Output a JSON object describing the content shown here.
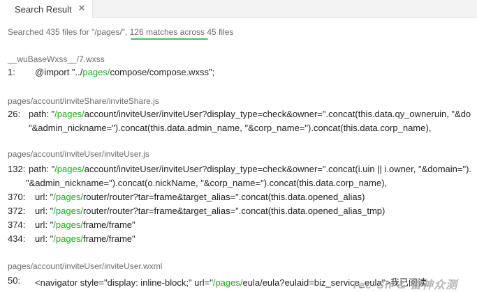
{
  "tab": {
    "label": "Search Result",
    "close_icon": "close-icon"
  },
  "summary": {
    "prefix": "Searched 435 files for \"/pages/\", ",
    "matches": "126 matches across 45 files"
  },
  "files": [
    {
      "path": "__wuBaseWxss__/7.wxss",
      "lines": [
        {
          "num": "1:",
          "pre": "@import \"../",
          "hl": "pages/",
          "post": "compose/compose.wxss\";"
        }
      ]
    },
    {
      "path": "pages/account/inviteShare/inviteShare.js",
      "lines": [
        {
          "num": "26:",
          "pre": "path: \"",
          "hl": "/pages/",
          "post": "account/inviteUser/inviteUser?display_type=check&owner=\".concat(this.data.qy_owneruin, \"&do"
        },
        {
          "num": "",
          "pre": "\"&admin_nickname=\").concat(this.data.admin_name, \"&corp_name=\").concat(this.data.corp_name),",
          "hl": "",
          "post": ""
        }
      ]
    },
    {
      "path": "pages/account/inviteUser/inviteUser.js",
      "lines": [
        {
          "num": "132:",
          "pre": "path: \"",
          "hl": "/pages/",
          "post": "account/inviteUser/inviteUser?display_type=check&owner=\".concat(i.uin || i.owner, \"&domain=\")."
        },
        {
          "num": "",
          "pre": "\"&admin_nickname=\").concat(o.nickName, \"&corp_name=\").concat(this.data.corp_name),",
          "hl": "",
          "post": ""
        },
        {
          "num": "370:",
          "pre": "url: \"",
          "hl": "/pages/",
          "post": "router/router?tar=frame&target_alias=\".concat(this.data.opened_alias)"
        },
        {
          "num": "372:",
          "pre": "url: \"",
          "hl": "/pages/",
          "post": "router/router?tar=frame&target_alias=\".concat(this.data.opened_alias_tmp)"
        },
        {
          "num": "374:",
          "pre": "url: \"",
          "hl": "/pages/",
          "post": "frame/frame\""
        },
        {
          "num": "434:",
          "pre": "url: \"",
          "hl": "/pages/",
          "post": "frame/frame\""
        }
      ]
    },
    {
      "path": "pages/account/inviteUser/inviteUser.wxml",
      "lines": [
        {
          "num": "50:",
          "pre": "<navigator style=\"display: inline-block;\" url=\"",
          "hl": "/pages/",
          "post": "eula/eula?eulaid=biz_service_eula\">我已阅读"
        }
      ]
    }
  ],
  "watermark": "Tec-Sir & 雷神众测"
}
